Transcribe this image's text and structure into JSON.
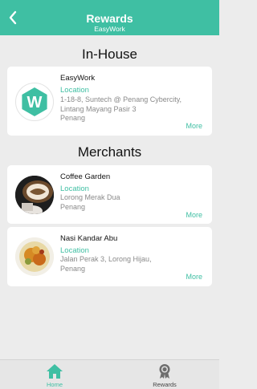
{
  "header": {
    "title": "Rewards",
    "subtitle": "EasyWork"
  },
  "sections": {
    "in_house_title": "In-House",
    "merchants_title": "Merchants"
  },
  "in_house": {
    "name": "EasyWork",
    "location_label": "Location",
    "address_line1": "1-18-8, Suntech @ Penang Cybercity,",
    "address_line2": "Lintang Mayang Pasir 3",
    "address_line3": "Penang",
    "more_label": "More",
    "logo_letter": "W",
    "logo_color": "#3fbfa3"
  },
  "merchants": [
    {
      "name": "Coffee Garden",
      "location_label": "Location",
      "address_line1": "Lorong Merak Dua",
      "address_line2": "Penang",
      "more_label": "More"
    },
    {
      "name": "Nasi Kandar Abu",
      "location_label": "Location",
      "address_line1": "Jalan Perak 3, Lorong Hijau,",
      "address_line2": "Penang",
      "more_label": "More"
    }
  ],
  "tabbar": {
    "home_label": "Home",
    "rewards_label": "Rewards",
    "active_color": "#3fbfa3",
    "inactive_color": "#444444",
    "home_icon": "home-icon",
    "rewards_icon": "medal-icon"
  }
}
